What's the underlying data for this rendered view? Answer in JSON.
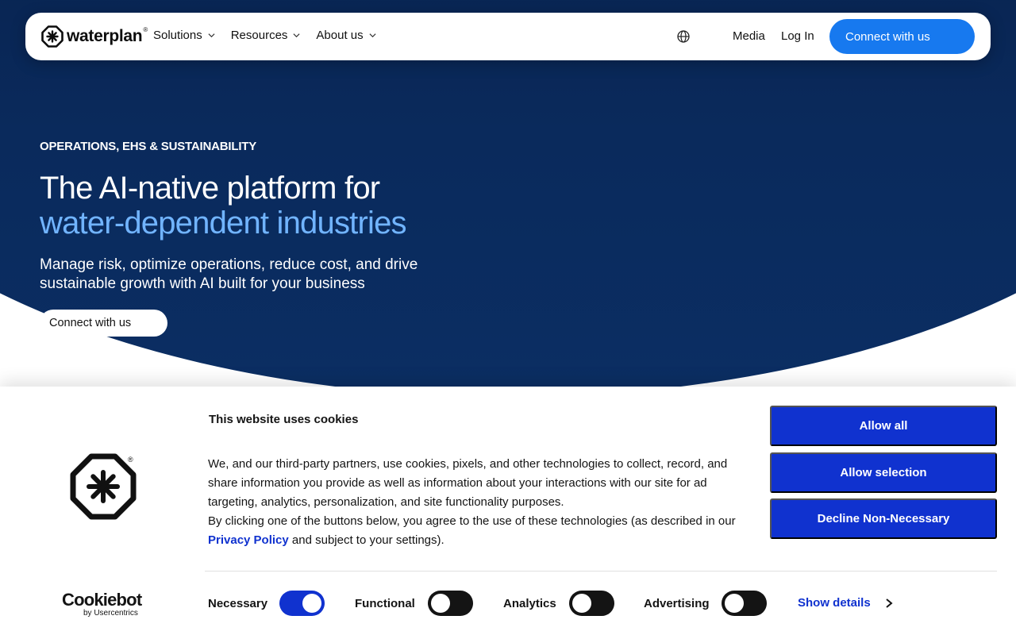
{
  "nav": {
    "logo_text": "waterplan",
    "logo_reg": "®",
    "menu": [
      {
        "label": "Solutions"
      },
      {
        "label": "Resources"
      },
      {
        "label": "About us"
      }
    ],
    "media_label": "Media",
    "login_label": "Log In",
    "cta_label": "Connect with us"
  },
  "hero": {
    "eyebrow": "OPERATIONS, EHS & SUSTAINABILITY",
    "headline_line1": "The AI-native platform for",
    "headline_line2": "water-dependent industries",
    "subheadline": "Manage risk, optimize operations, reduce cost, and drive sustainable growth with AI built for your business",
    "cta_label": "Connect with us"
  },
  "cookie": {
    "title": "This website uses cookies",
    "body_part1": "We, and our third-party partners, use cookies, pixels, and other technologies to collect, record, and share information you provide as well as information about your interactions with our site for ad targeting, analytics, personalization, and site functionality purposes.",
    "body_part2": "By clicking one of the buttons below, you agree to the use of these technologies (as described in our ",
    "privacy_link": "Privacy Policy",
    "body_part3": " and subject to your settings).",
    "buttons": {
      "allow_all": "Allow all",
      "allow_selection": "Allow selection",
      "decline": "Decline Non-Necessary"
    },
    "toggles": [
      {
        "label": "Necessary",
        "state": "on"
      },
      {
        "label": "Functional",
        "state": "off"
      },
      {
        "label": "Analytics",
        "state": "off"
      },
      {
        "label": "Advertising",
        "state": "off"
      }
    ],
    "show_details": "Show details",
    "brand": {
      "name": "Cookiebot",
      "by": "by Usercentrics",
      "reg": "®"
    }
  },
  "colors": {
    "hero_dark": "#07204a",
    "nav_cta": "#1779ef",
    "highlight": "#71b4ff",
    "cookie_blue": "#1032cf",
    "toggle_off": "#141414"
  },
  "icons": {
    "logo": "waterplan-asterisk-octagon-icon",
    "chevron": "chevron-down-icon",
    "globe": "globe-icon",
    "show_details": "chevron-right-icon"
  }
}
